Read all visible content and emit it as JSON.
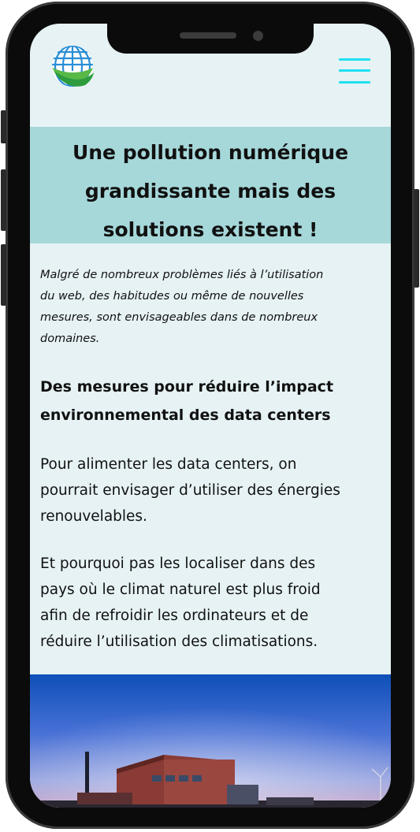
{
  "header": {
    "logo_icon": "globe-leaf-logo",
    "menu_icon": "hamburger-menu-icon",
    "menu_color": "#1ee0f0"
  },
  "title_band": {
    "title_lines": [
      "Une pollution numérique",
      "grandissante mais des",
      "solutions existent !"
    ],
    "background": "#a6d8da"
  },
  "intro": {
    "lines": [
      "Malgré de nombreux problèmes liés à l’utilisation",
      "du web, des habitudes ou même de nouvelles",
      "mesures, sont envisageables dans de nombreux",
      "domaines."
    ]
  },
  "section": {
    "heading_lines": [
      "Des mesures pour réduire l’impact",
      "environnemental des data centers"
    ],
    "p1_lines": [
      "Pour alimenter les data centers, on",
      "pourrait envisager d’utiliser des énergies",
      "renouvelables."
    ],
    "p2_lines": [
      "Et pourquoi pas les localiser dans des",
      "pays où le climat naturel est plus froid",
      "afin de refroidir les ordinateurs et de",
      "réduire l’utilisation des climatisations."
    ]
  },
  "colors": {
    "page_bg": "#e6f2f4",
    "text": "#111111"
  }
}
